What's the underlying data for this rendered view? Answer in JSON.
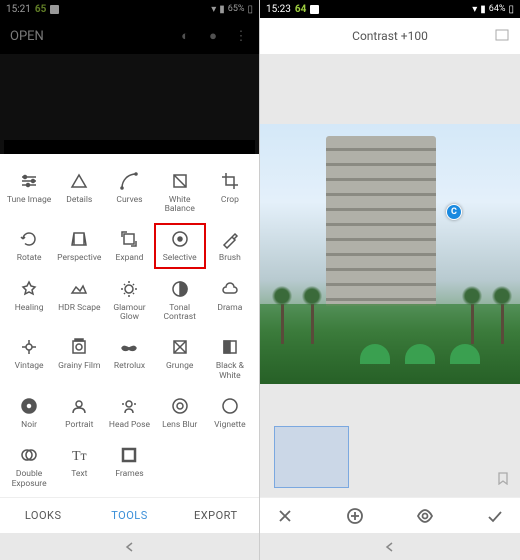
{
  "left": {
    "status": {
      "time": "15:21",
      "temp": "65",
      "battery": "65%"
    },
    "header": {
      "open_label": "OPEN"
    },
    "tools": [
      {
        "id": "tune-image",
        "label": "Tune Image",
        "icon": "sliders"
      },
      {
        "id": "details",
        "label": "Details",
        "icon": "triangle"
      },
      {
        "id": "curves",
        "label": "Curves",
        "icon": "curve"
      },
      {
        "id": "white-balance",
        "label": "White\nBalance",
        "icon": "wb"
      },
      {
        "id": "crop",
        "label": "Crop",
        "icon": "crop"
      },
      {
        "id": "rotate",
        "label": "Rotate",
        "icon": "rotate"
      },
      {
        "id": "perspective",
        "label": "Perspective",
        "icon": "perspective"
      },
      {
        "id": "expand",
        "label": "Expand",
        "icon": "expand"
      },
      {
        "id": "selective",
        "label": "Selective",
        "icon": "target",
        "highlight": true
      },
      {
        "id": "brush",
        "label": "Brush",
        "icon": "brush"
      },
      {
        "id": "healing",
        "label": "Healing",
        "icon": "heal"
      },
      {
        "id": "hdr-scape",
        "label": "HDR Scape",
        "icon": "hdr"
      },
      {
        "id": "glamour-glow",
        "label": "Glamour\nGlow",
        "icon": "glow"
      },
      {
        "id": "tonal-contrast",
        "label": "Tonal\nContrast",
        "icon": "halfcircle"
      },
      {
        "id": "drama",
        "label": "Drama",
        "icon": "cloud"
      },
      {
        "id": "vintage",
        "label": "Vintage",
        "icon": "vintage"
      },
      {
        "id": "grainy-film",
        "label": "Grainy Film",
        "icon": "film"
      },
      {
        "id": "retrolux",
        "label": "Retrolux",
        "icon": "moustache"
      },
      {
        "id": "grunge",
        "label": "Grunge",
        "icon": "grunge"
      },
      {
        "id": "black-white",
        "label": "Black &\nWhite",
        "icon": "bw"
      },
      {
        "id": "noir",
        "label": "Noir",
        "icon": "noir"
      },
      {
        "id": "portrait",
        "label": "Portrait",
        "icon": "portrait"
      },
      {
        "id": "head-pose",
        "label": "Head Pose",
        "icon": "headpose"
      },
      {
        "id": "lens-blur",
        "label": "Lens Blur",
        "icon": "lensblur"
      },
      {
        "id": "vignette",
        "label": "Vignette",
        "icon": "vignette"
      },
      {
        "id": "double-exposure",
        "label": "Double\nExposure",
        "icon": "dbl"
      },
      {
        "id": "text",
        "label": "Text",
        "icon": "text"
      },
      {
        "id": "frames",
        "label": "Frames",
        "icon": "frames"
      }
    ],
    "tabs": {
      "looks": "LOOKS",
      "tools": "TOOLS",
      "export": "EXPORT",
      "active": "tools"
    }
  },
  "right": {
    "status": {
      "time": "15:23",
      "temp": "64",
      "battery": "64%"
    },
    "edit_label": "Contrast +100",
    "selective_point": "C"
  },
  "icons": {
    "sliders": "<path d='M3 6h14M3 10h14M3 14h14'/><circle cx='6' cy='6' r='1.5' fill='#555'/><circle cx='14' cy='10' r='1.5' fill='#555'/><circle cx='9' cy='14' r='1.5' fill='#555'/>",
    "triangle": "<path d='M10 4l7 12H3z'/>",
    "curve": "<path d='M3 17c0-8 6-14 14-14'/><circle cx='3' cy='17' r='1' fill='#555'/><circle cx='17' cy='3' r='1' fill='#555'/>",
    "wb": "<rect x='4' y='4' width='12' height='12'/><path d='M4 4l12 12'/>",
    "crop": "<path d='M6 2v12h12M2 6h12v12'/>",
    "rotate": "<path d='M4 10a6 6 0 1 1 2 4.5M4 10l-2-2m2 2l2-2'/>",
    "perspective": "<path d='M5 4h10l2 12H3z M5 4v12 M15 4v12'/>",
    "expand": "<rect x='5' y='5' width='10' height='10'/><path d='M3 8V3h5M17 12v5h-5'/>",
    "target": "<circle cx='10' cy='10' r='7'/><circle cx='10' cy='10' r='2' fill='#555'/>",
    "brush": "<path d='M4 16l8-8 3 3-8 8z M12 8l3-3 2 2-3 3'/>",
    "heal": "<path d='M10 3l2 4 4 1-3 3 1 4-4-2-4 2 1-4-3-3 4-1z'/>",
    "hdr": "<path d='M3 14l4-6 4 4 3-5 3 7z'/>",
    "glow": "<circle cx='10' cy='10' r='4'/><path d='M10 2v2M10 16v2M2 10h2M16 10h2M5 5l1 1M14 14l1 1M15 5l-1 1M6 14l-1 1'/>",
    "halfcircle": "<circle cx='10' cy='10' r='7'/><path d='M10 3a7 7 0 0 1 0 14z' fill='#555'/>",
    "cloud": "<path d='M6 14a3 3 0 0 1 0-6 4 4 0 0 1 8 0 3 3 0 0 1 0 6z'/>",
    "vintage": "<path d='M10 3v4M10 13v4M3 10h4M13 10h4'/><circle cx='10' cy='10' r='3'/>",
    "film": "<rect x='4' y='4' width='12' height='12'/><circle cx='10' cy='10' r='3'/><rect x='6' y='2' width='8' height='2' fill='#555'/>",
    "moustache": "<path d='M3 11c2-3 4-1 7 0 3-1 5-3 7 0-1 3-5 3-7 1-2 2-6 2-7-1z' fill='#555'/>",
    "grunge": "<rect x='4' y='4' width='12' height='12'/><path d='M4 4l12 12M16 4L4 16'/>",
    "bw": "<rect x='4' y='4' width='12' height='12'/><path d='M4 4h6v12H4z' fill='#555'/>",
    "noir": "<circle cx='10' cy='10' r='7' fill='#555'/><circle cx='10' cy='10' r='3' fill='#fff'/>",
    "portrait": "<circle cx='10' cy='8' r='3'/><path d='M4 17c0-4 3-5 6-5s6 1 6 5'/>",
    "headpose": "<circle cx='10' cy='8' r='3'/><path d='M6 17c0-3 2-4 4-4s4 1 4 4M3 8h2M15 8h2'/>",
    "lensblur": "<circle cx='10' cy='10' r='7'/><circle cx='10' cy='10' r='3'/>",
    "vignette": "<rect x='3' y='3' width='14' height='14' rx='7'/>",
    "dbl": "<circle cx='8' cy='10' r='5'/><circle cx='12' cy='10' r='5'/>",
    "text": "<text x='3' y='15' font-size='14' fill='#555' stroke='none' font-family='serif'>Tт</text>",
    "frames": "<rect x='4' y='4' width='12' height='12' stroke-width='2.5'/>"
  }
}
